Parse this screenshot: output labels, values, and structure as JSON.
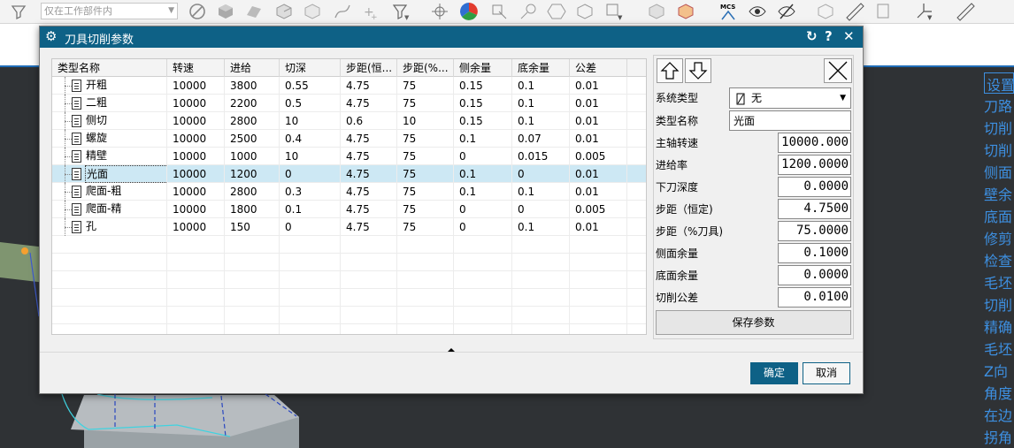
{
  "toolbar": {
    "scope_placeholder": "仅在工作部件内",
    "mcs_label": "MCS"
  },
  "dialog": {
    "title": "刀具切削参数",
    "ok_label": "确定",
    "cancel_label": "取消"
  },
  "table": {
    "headers": [
      "类型名称",
      "转速",
      "进给",
      "切深",
      "步距(恒...",
      "步距(%...",
      "侧余量",
      "底余量",
      "公差"
    ],
    "rows": [
      {
        "name": "开粗",
        "speed": "10000",
        "feed": "3800",
        "depth": "0.55",
        "stepover": "4.75",
        "stepover_pct": "75",
        "side_stock": "0.15",
        "floor_stock": "0.1",
        "tolerance": "0.01"
      },
      {
        "name": "二粗",
        "speed": "10000",
        "feed": "2200",
        "depth": "0.5",
        "stepover": "4.75",
        "stepover_pct": "75",
        "side_stock": "0.15",
        "floor_stock": "0.1",
        "tolerance": "0.01"
      },
      {
        "name": "侧切",
        "speed": "10000",
        "feed": "2800",
        "depth": "10",
        "stepover": "0.6",
        "stepover_pct": "10",
        "side_stock": "0.15",
        "floor_stock": "0.1",
        "tolerance": "0.01"
      },
      {
        "name": "螺旋",
        "speed": "10000",
        "feed": "2500",
        "depth": "0.4",
        "stepover": "4.75",
        "stepover_pct": "75",
        "side_stock": "0.1",
        "floor_stock": "0.07",
        "tolerance": "0.01"
      },
      {
        "name": "精壁",
        "speed": "10000",
        "feed": "1000",
        "depth": "10",
        "stepover": "4.75",
        "stepover_pct": "75",
        "side_stock": "0",
        "floor_stock": "0.015",
        "tolerance": "0.005"
      },
      {
        "name": "光面",
        "speed": "10000",
        "feed": "1200",
        "depth": "0",
        "stepover": "4.75",
        "stepover_pct": "75",
        "side_stock": "0.1",
        "floor_stock": "0",
        "tolerance": "0.01"
      },
      {
        "name": "爬面-粗",
        "speed": "10000",
        "feed": "2800",
        "depth": "0.3",
        "stepover": "4.75",
        "stepover_pct": "75",
        "side_stock": "0.1",
        "floor_stock": "0.1",
        "tolerance": "0.01"
      },
      {
        "name": "爬面-精",
        "speed": "10000",
        "feed": "1800",
        "depth": "0.1",
        "stepover": "4.75",
        "stepover_pct": "75",
        "side_stock": "0",
        "floor_stock": "0",
        "tolerance": "0.005"
      },
      {
        "name": "孔",
        "speed": "10000",
        "feed": "150",
        "depth": "0",
        "stepover": "4.75",
        "stepover_pct": "75",
        "side_stock": "0",
        "floor_stock": "0.1",
        "tolerance": "0.01"
      }
    ],
    "selected_row": 5
  },
  "form": {
    "system_type_label": "系统类型",
    "system_type_value": "无",
    "type_name_label": "类型名称",
    "type_name_value": "光面",
    "spindle_label": "主轴转速",
    "spindle_value": "10000.000",
    "feed_label": "进给率",
    "feed_value": "1200.0000",
    "depth_label": "下刀深度",
    "depth_value": "0.0000",
    "stepover_label": "步距（恒定)",
    "stepover_value": "4.7500",
    "stepover_pct_label": "步距（%刀具)",
    "stepover_pct_value": "75.0000",
    "side_stock_label": "侧面余量",
    "side_stock_value": "0.1000",
    "floor_stock_label": "底面余量",
    "floor_stock_value": "0.0000",
    "tolerance_label": "切削公差",
    "tolerance_value": "0.0100",
    "save_label": "保存参数"
  },
  "right_panel": {
    "items": [
      "设置",
      "刀路",
      "切削",
      "切削",
      "侧面",
      "壁余",
      "底面",
      "修剪",
      "检查",
      "毛坯",
      "切削",
      "精确",
      "毛坯",
      "Z向",
      "角度",
      "在边",
      "拐角"
    ]
  },
  "colors": {
    "title_bar": "#0e6186",
    "selected_row": "#cde8f4",
    "viewport_bg": "#2f3235",
    "right_panel_text": "#3d8fe0"
  }
}
